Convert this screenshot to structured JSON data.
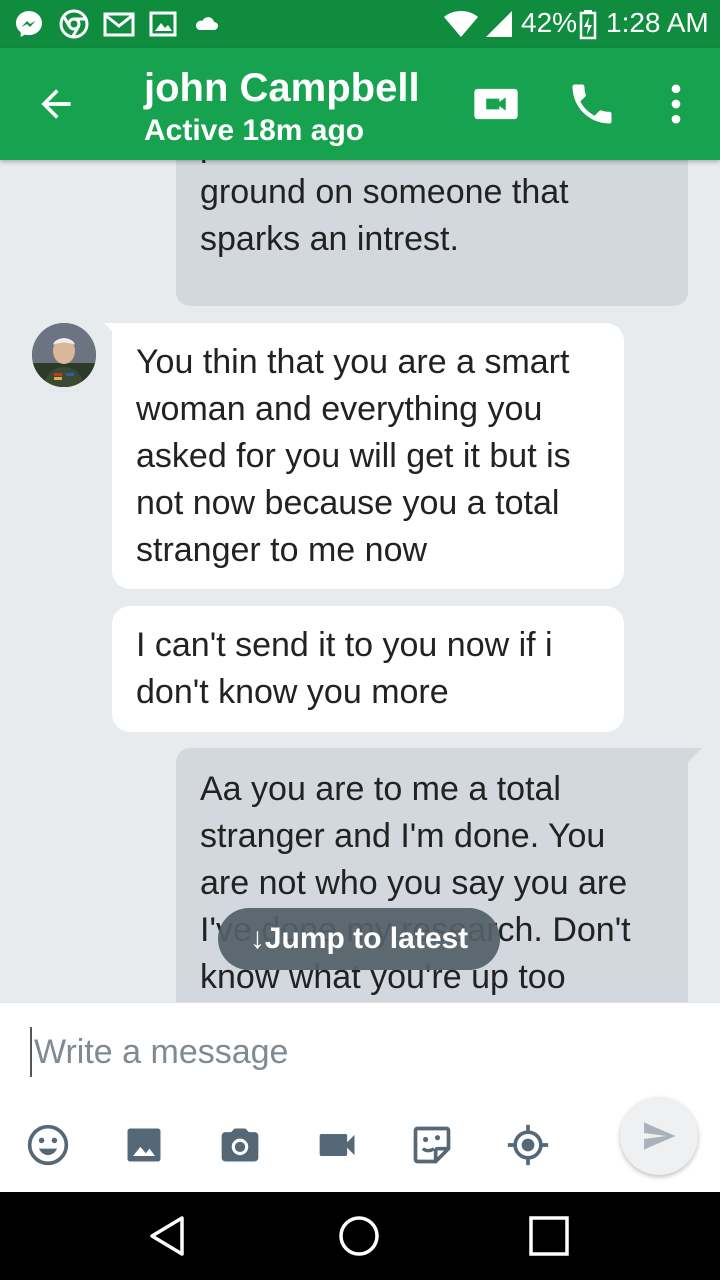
{
  "status_bar": {
    "battery": "42%",
    "time": "1:28 AM"
  },
  "header": {
    "title": "john Campbell",
    "subtitle": "Active 18m ago"
  },
  "messages": [
    {
      "direction": "outgoing",
      "lines": [
        "pull but most women do back",
        "ground on someone that",
        "sparks an intrest."
      ]
    },
    {
      "direction": "incoming",
      "lines": [
        "You thin that you are a smart",
        "woman and everything you",
        "asked for you will get it but is",
        "not now because you a total",
        "stranger to me now"
      ]
    },
    {
      "direction": "incoming",
      "lines": [
        "I can't send it to you now if i",
        "don't know you more"
      ]
    },
    {
      "direction": "outgoing",
      "lines": [
        "Aa you are to me a total",
        "stranger and I'm done. You",
        "are not who you say you are",
        "I've done my research. Don't",
        "know what you're up too"
      ]
    }
  ],
  "jump_to_latest": "Jump to latest",
  "composer": {
    "placeholder": "Write a message",
    "value": ""
  },
  "colors": {
    "status_bar": "#0f8c3e",
    "app_bar": "#16a24f",
    "outgoing_bubble": "#d2d8de",
    "incoming_bubble": "#ffffff",
    "composer_icons": "#546878"
  },
  "icons": {
    "status_bar": [
      "messenger-icon",
      "chrome-icon",
      "gmail-icon",
      "image-icon",
      "cloud-icon",
      "wifi-icon",
      "signal-icon",
      "battery-charging-icon"
    ],
    "app_bar": [
      "back-arrow-icon",
      "video-call-icon",
      "phone-icon",
      "more-vert-icon"
    ],
    "composer": [
      "emoji-icon",
      "image-icon",
      "camera-icon",
      "video-icon",
      "sticker-icon",
      "location-icon",
      "send-icon"
    ],
    "nav": [
      "back-triangle-icon",
      "home-circle-icon",
      "recents-square-icon"
    ]
  }
}
